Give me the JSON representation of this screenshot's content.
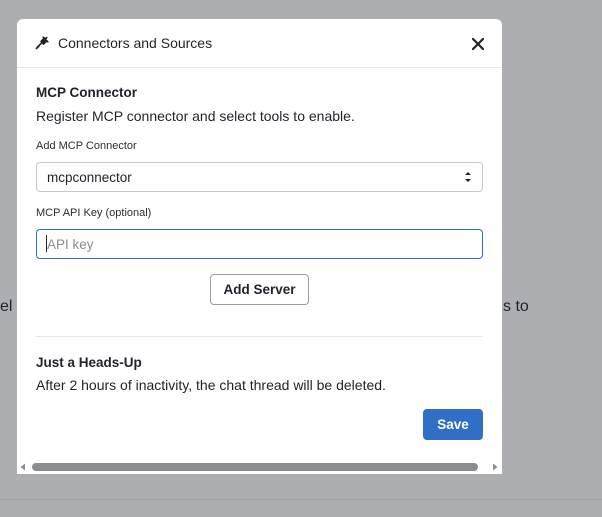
{
  "background": {
    "left_fragment": "el",
    "right_fragment": "s to"
  },
  "modal": {
    "title": "Connectors and Sources",
    "icons": {
      "title_icon": "plug-icon",
      "close": "close-icon"
    },
    "mcp_section": {
      "title": "MCP Connector",
      "description": "Register MCP connector and select tools to enable."
    },
    "connector_field": {
      "label": "Add MCP Connector",
      "selected_value": "mcpconnector"
    },
    "api_key_field": {
      "label": "MCP API Key (optional)",
      "value": "",
      "placeholder": "API key"
    },
    "add_server_label": "Add Server",
    "notice": {
      "title": "Just a Heads-Up",
      "text": "After 2 hours of inactivity, the chat thread will be deleted."
    },
    "save_label": "Save"
  },
  "colors": {
    "overlay": "#adaeb2",
    "accent": "#2f6fc5",
    "text": "#1f2329"
  }
}
